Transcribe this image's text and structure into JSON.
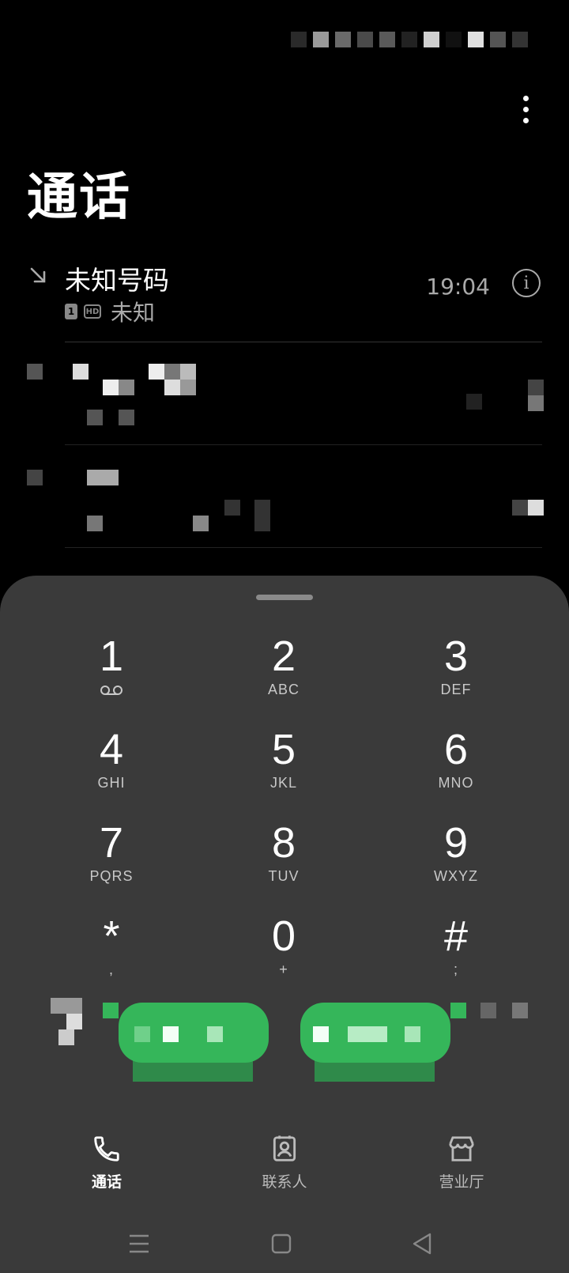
{
  "page": {
    "title": "通话"
  },
  "calls": [
    {
      "name": "未知号码",
      "sim": "1",
      "hd": "HD",
      "location": "未知",
      "time": "19:04",
      "type": "incoming-missed"
    }
  ],
  "dialpad": {
    "keys": [
      {
        "digit": "1",
        "letters": ""
      },
      {
        "digit": "2",
        "letters": "ABC"
      },
      {
        "digit": "3",
        "letters": "DEF"
      },
      {
        "digit": "4",
        "letters": "GHI"
      },
      {
        "digit": "5",
        "letters": "JKL"
      },
      {
        "digit": "6",
        "letters": "MNO"
      },
      {
        "digit": "7",
        "letters": "PQRS"
      },
      {
        "digit": "8",
        "letters": "TUV"
      },
      {
        "digit": "9",
        "letters": "WXYZ"
      },
      {
        "digit": "*",
        "letters": ","
      },
      {
        "digit": "0",
        "letters": "+"
      },
      {
        "digit": "#",
        "letters": ";"
      }
    ]
  },
  "bottom_nav": {
    "calls": "通话",
    "contacts": "联系人",
    "store": "营业厅"
  },
  "colors": {
    "accent": "#35b65a",
    "panel": "#3a3a3a"
  },
  "icons": [
    "more-vert-icon",
    "incoming-call-icon",
    "info-icon",
    "voicemail-icon",
    "phone-icon",
    "contacts-icon",
    "store-icon",
    "menu-icon",
    "home-icon",
    "back-icon"
  ]
}
